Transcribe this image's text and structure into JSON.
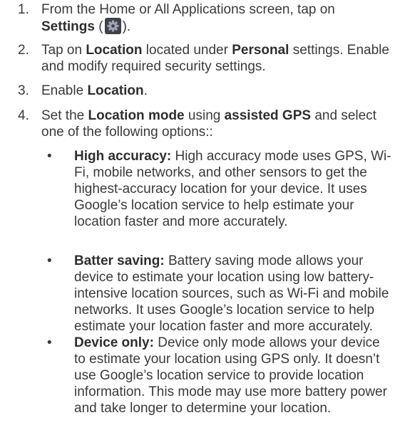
{
  "steps": [
    {
      "number": "1.",
      "line1": "From the Home or All Applications screen, tap on",
      "bold1": "Settings",
      "paren_open": " (",
      "paren_close": ")."
    },
    {
      "number": "2.",
      "pre": "Tap on ",
      "bold1": "Location",
      "mid": " located under ",
      "bold2": "Personal",
      "post": " settings. Enable and modify required security settings."
    },
    {
      "number": "3.",
      "pre": "Enable ",
      "bold1": "Location",
      "post": "."
    },
    {
      "number": "4.",
      "pre": "Set the ",
      "bold1": "Location mode",
      "mid": " using ",
      "bold2": "assisted GPS",
      "post": " and select  one of the following options::"
    }
  ],
  "options": [
    {
      "bullet": "•",
      "title": "High accuracy:",
      "text": " High accuracy mode uses GPS, Wi-Fi, mobile networks, and other sensors to get the highest-accuracy location for your device. It uses Google’s location service to help estimate your location faster and more accurately."
    },
    {
      "bullet": "•",
      "title": "Batter saving:",
      "text": " Battery saving mode allows your device to estimate your location using low battery-intensive location sources, such as Wi-Fi and mobile networks. It uses Google’s location service to help estimate your location faster and more accurately."
    },
    {
      "bullet": "•",
      "title": "Device only:",
      "text": " Device only mode allows your device to estimate your location using GPS only. It doesn’t use Google’s location service to provide location information. This mode may use more battery power and take longer to determine your location."
    }
  ],
  "icons": {
    "settings": "settings-gear-icon",
    "gear_bg": "#3f4247",
    "gear_fg": "#9aa5b1"
  }
}
